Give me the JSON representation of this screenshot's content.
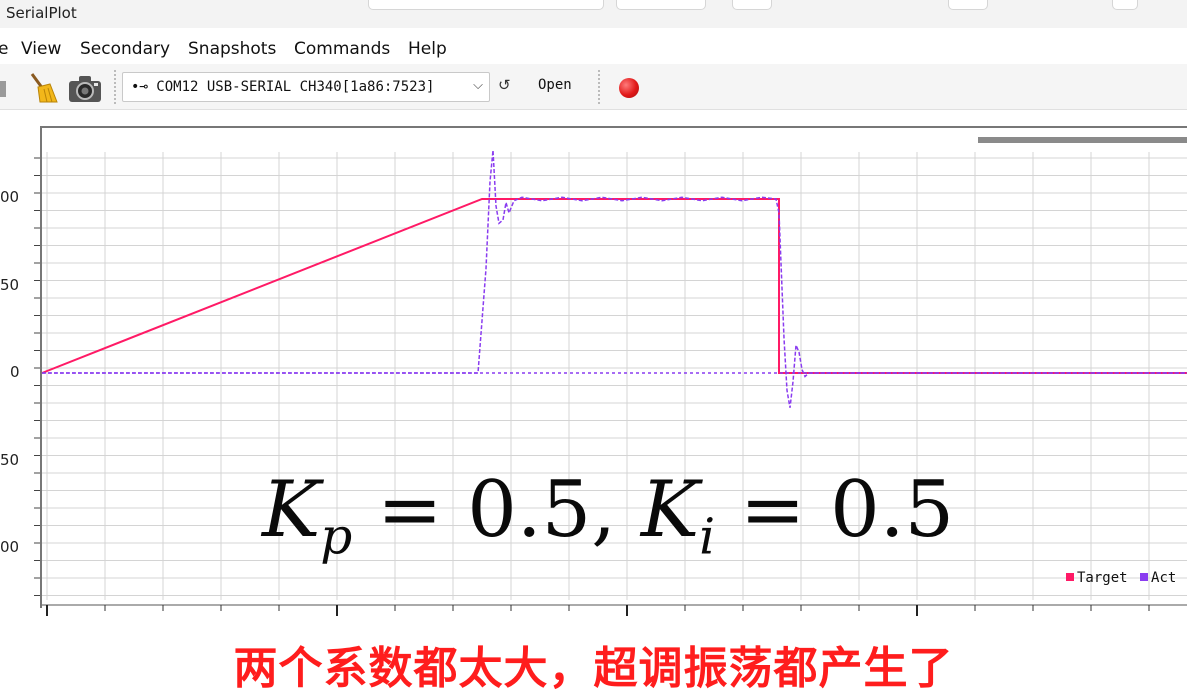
{
  "window": {
    "title": "SerialPlot"
  },
  "menu": {
    "items": [
      {
        "label": "e",
        "underline": ""
      },
      {
        "label": "View"
      },
      {
        "label": "Secondary"
      },
      {
        "label": "Snapshots"
      },
      {
        "label": "Commands"
      },
      {
        "label": "Help"
      }
    ]
  },
  "toolbar": {
    "port": "COM12 USB-SERIAL CH340[1a86:7523]",
    "open_label": "Open",
    "refresh_glyph": "↺",
    "combo_arrow": "⌵"
  },
  "plot": {
    "y_ticks": [
      "00",
      "50",
      "0",
      "50",
      "00"
    ],
    "legend": [
      {
        "name": "Target",
        "color": "#ff1a66"
      },
      {
        "name": "Act",
        "color": "#8a3cf0"
      }
    ],
    "colors": {
      "target": "#ff1a66",
      "actual": "#8a3cf0",
      "grid": "#d4d4d4"
    }
  },
  "overlay": {
    "formula_k1": "K",
    "formula_sub1": "p",
    "formula_mid": " = 0.5, ",
    "formula_k2": "K",
    "formula_sub2": "i",
    "formula_end": " = 0.5"
  },
  "caption": {
    "text": "两个系数都太大，超调振荡都产生了"
  },
  "chart_data": {
    "type": "line",
    "series": [
      {
        "name": "Target",
        "x": [
          0,
          440,
          440,
          737,
          737,
          1147
        ],
        "values": [
          0,
          100,
          100,
          100,
          0,
          0
        ]
      },
      {
        "name": "Act"
      }
    ],
    "grid": true,
    "legend_position": "bottom-right"
  }
}
